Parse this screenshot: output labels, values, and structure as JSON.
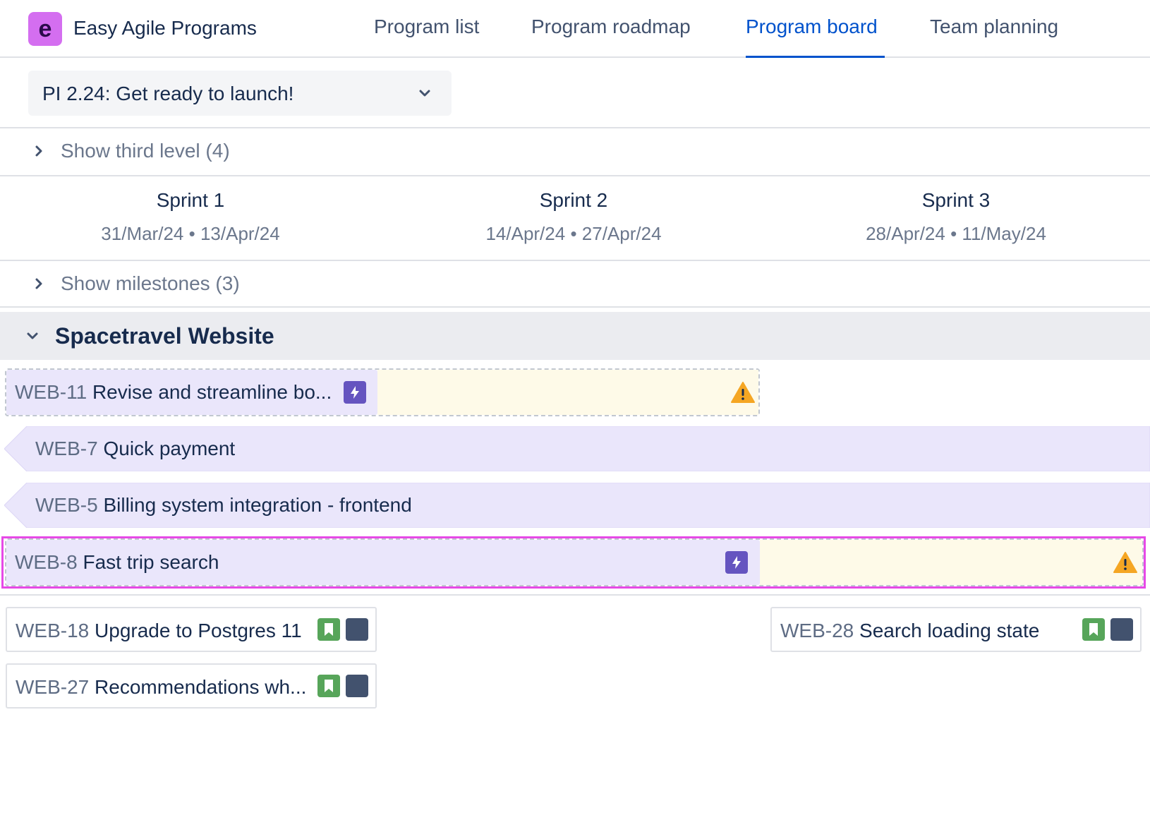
{
  "header": {
    "app_title": "Easy Agile Programs",
    "logo_letter": "e",
    "tabs": [
      {
        "label": "Program list",
        "active": false
      },
      {
        "label": "Program roadmap",
        "active": false
      },
      {
        "label": "Program board",
        "active": true
      },
      {
        "label": "Team planning",
        "active": false
      }
    ]
  },
  "pi_selector": {
    "value": "PI 2.24: Get ready to launch!"
  },
  "toggles": {
    "third_level": "Show third level (4)",
    "milestones": "Show milestones (3)"
  },
  "sprints": [
    {
      "name": "Sprint 1",
      "start": "31/Mar/24",
      "end": "13/Apr/24"
    },
    {
      "name": "Sprint 2",
      "start": "14/Apr/24",
      "end": "27/Apr/24"
    },
    {
      "name": "Sprint 3",
      "start": "28/Apr/24",
      "end": "11/May/24"
    }
  ],
  "date_separator": "•",
  "team": {
    "name": "Spacetravel Website"
  },
  "features": [
    {
      "key": "WEB-11",
      "title": "Revise and streamline bo...",
      "warning": true
    },
    {
      "key": "WEB-7",
      "title": "Quick payment",
      "warning": false
    },
    {
      "key": "WEB-5",
      "title": "Billing system integration - frontend",
      "warning": false
    },
    {
      "key": "WEB-8",
      "title": "Fast trip search",
      "warning": true
    }
  ],
  "stories": [
    {
      "key": "WEB-18",
      "title": "Upgrade to Postgres 11"
    },
    {
      "key": "WEB-28",
      "title": "Search loading state"
    },
    {
      "key": "WEB-27",
      "title": "Recommendations wh..."
    }
  ],
  "colors": {
    "accent": "#0052cc",
    "logo": "#d46ef0",
    "epic": "#6554c0",
    "feature_bg": "#eae6fb",
    "warning_bg": "#fefae8",
    "warning_icon": "#f5a623",
    "story_icon": "#57a55a",
    "avatar": "#42526e",
    "highlight": "#e649e6"
  }
}
